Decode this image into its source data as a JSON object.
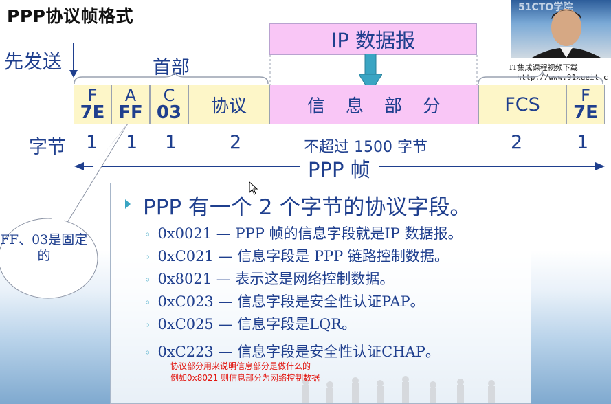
{
  "title": "PPP协议帧格式",
  "send_first": "先发送",
  "header_label": "首部",
  "ip_datagram": "IP 数据报",
  "fields": [
    {
      "letter": "F",
      "hex": "7E"
    },
    {
      "letter": "A",
      "hex": "FF"
    },
    {
      "letter": "C",
      "hex": "03"
    },
    {
      "label": "协议"
    },
    {
      "label": "信息部分"
    },
    {
      "label": "FCS"
    },
    {
      "letter": "F",
      "hex": "7E"
    }
  ],
  "bytes": {
    "label": "字节",
    "values": [
      "1",
      "1",
      "1",
      "2",
      "不超过 1500 字节",
      "2",
      "1"
    ]
  },
  "frame_caption": "PPP 帧",
  "callout": "FF、03是固定的",
  "watermark": {
    "line1": "IT集成课程视频下载",
    "line2": "http://www.91xueit.c"
  },
  "logo_text": "51CTO学院",
  "card": {
    "heading": "PPP 有一个 2 个字节的协议字段。",
    "items": [
      "0x0021 — PPP 帧的信息字段就是IP 数据报。",
      "0xC021 — 信息字段是 PPP 链路控制数据。",
      "0x8021 — 表示这是网络控制数据。",
      "0xC023 — 信息字段是安全性认证PAP。",
      "0xC025 — 信息字段是LQR。",
      "0xC223 — 信息字段是安全性认证CHAP。"
    ],
    "notes": [
      "协议部分用来说明信息部分是做什么的",
      "例如0x8021 则信息部分为网络控制数据"
    ]
  },
  "colors": {
    "text_blue": "#1f3f8e",
    "pink": "#f9c6f6",
    "yellow": "#fdf6c8",
    "teal": "#3aa5c3",
    "note_red": "#e2150f"
  }
}
